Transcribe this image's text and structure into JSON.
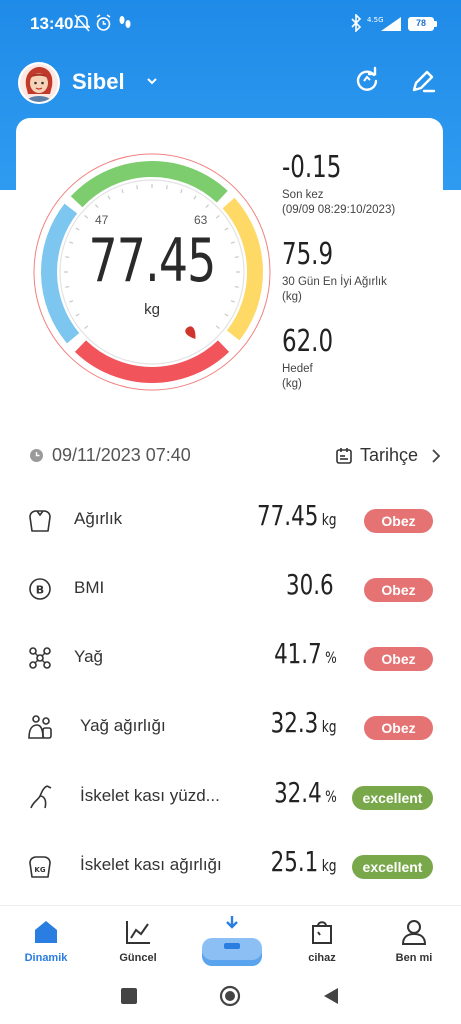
{
  "status_bar": {
    "time": "13:40",
    "battery": "78"
  },
  "header": {
    "user_name": "Sibel",
    "icons": [
      "refresh-icon",
      "edit-icon"
    ]
  },
  "gauge": {
    "value": "77.45",
    "unit": "kg",
    "range_min_label": "47",
    "range_max_label": "63",
    "segment_colors": [
      "#7cc6ef",
      "#7dcd6e",
      "#ffd966",
      "#f2545b"
    ]
  },
  "stats": {
    "last": {
      "value": "-0.15",
      "label1": "Son kez",
      "label2": "(09/09 08:29:10/2023)"
    },
    "best": {
      "value": "75.9",
      "label1": "30 Gün En İyi Ağırlık",
      "label2": "(kg)"
    },
    "goal": {
      "value": "62.0",
      "label1": "Hedef",
      "label2": "(kg)"
    }
  },
  "measure": {
    "datetime": "09/11/2023 07:40",
    "history_label": "Tarihçe"
  },
  "metrics": [
    {
      "label": "Ağırlık",
      "value": "77.45",
      "unit": "kg",
      "badge": "Obez",
      "badge_color": "#e57373",
      "icon": "weight-icon"
    },
    {
      "label": "BMI",
      "value": "30.6",
      "unit": "",
      "badge": "Obez",
      "badge_color": "#e57373",
      "icon": "bmi-icon"
    },
    {
      "label": "Yağ",
      "value": "41.7",
      "unit": "%",
      "badge": "Obez",
      "badge_color": "#e57373",
      "icon": "fat-icon"
    },
    {
      "label": "Yağ ağırlığı",
      "value": "32.3",
      "unit": "kg",
      "badge": "Obez",
      "badge_color": "#e57373",
      "icon": "fat-weight-icon"
    },
    {
      "label": "İskelet kası yüzd...",
      "value": "32.4",
      "unit": "%",
      "badge": "excellent",
      "badge_color": "#78a84a",
      "icon": "muscle-percent-icon"
    },
    {
      "label": "İskelet kası ağırlığı",
      "value": "25.1",
      "unit": "kg",
      "badge": "excellent",
      "badge_color": "#78a84a",
      "icon": "muscle-weight-icon"
    }
  ],
  "nav": {
    "items": [
      {
        "label": "Dinamik",
        "icon": "home-icon",
        "active": true
      },
      {
        "label": "Güncel",
        "icon": "chart-icon",
        "active": false
      },
      {
        "label": "",
        "icon": "scale-icon",
        "active": false
      },
      {
        "label": "cihaz",
        "icon": "device-icon",
        "active": false
      },
      {
        "label": "Ben mi",
        "icon": "profile-icon",
        "active": false
      }
    ],
    "active_color": "#2a7de1"
  }
}
